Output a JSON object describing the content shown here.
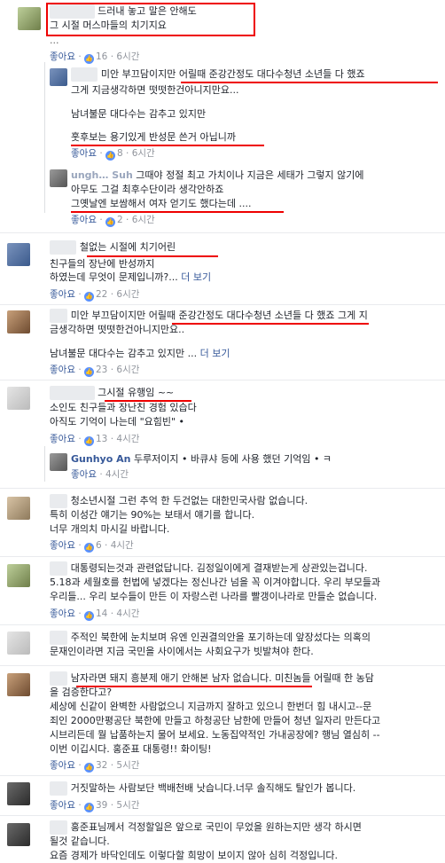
{
  "comments": [
    {
      "name": "",
      "lines": [
        "드러내 놓고 말은 안해도",
        "그 시절 머스마들의 치기지요"
      ],
      "extra": "...",
      "likes": "16",
      "time": "6시간"
    },
    {
      "name": "",
      "lines": [
        "미안 부끄담이지만 어릴때 준강간정도 대다수청년 소년들 다 했죠",
        "그게 지금생각하면 떳떳한건아니지만요...",
        "",
        "남녀불문 대다수는 감추고 있지만",
        "",
        "훗후보는 용기있게 반성문 쓴거 아닙니까"
      ],
      "likes": "8",
      "time": "6시간"
    },
    {
      "name": "ungh… Suh",
      "lines": [
        "그때야 정절 최고 가치이나 지금은 세태가 그렇지 않기에",
        "아무도 그걸 최후수단이라 생각안하죠",
        "그옛날엔 보쌈해서 여자 얻기도 했다는데 ...."
      ],
      "likes": "2",
      "time": "6시간"
    },
    {
      "name": "",
      "lines": [
        "철없는 시절에 치기어린",
        "친구들의 장난에 반성까지",
        "하였는데 무엇이 문제입니까?..."
      ],
      "more": "더 보기",
      "likes": "22",
      "time": "6시간"
    },
    {
      "name": "",
      "lines": [
        "미안 부끄담이지만 어릴때 준강간정도 대다수청년 소년들 다 했죠 그게 지",
        "금생각하면 떳떳한건아니지만요..",
        "",
        "남녀불문 대다수는 감추고 있지만 ..."
      ],
      "more": "더 보기",
      "likes": "23",
      "time": "6시간"
    },
    {
      "name": "",
      "lines": [
        "그시절 유행임 ~~",
        "소인도 친구들과 장난친 경험 있습다",
        "아직도 기억이 나는데 \"요힘빈\" •"
      ],
      "likes": "13",
      "time": "4시간"
    },
    {
      "name": "Gunhyo An",
      "lines": [
        "두루저이지 • 바큐샤 등에 사용 했던 기억임 • ㅋ"
      ],
      "time": "4시간"
    },
    {
      "name": "",
      "lines": [
        "청소년시절 그런 추억 한 두건없는 대한민국사람 없습니다.",
        "특히 이성간 얘기는 90%는 보태서 얘기를 합니다.",
        "너무 개의치 마시길 바랍니다."
      ],
      "likes": "6",
      "time": "4시간"
    },
    {
      "name": "",
      "lines": [
        "대통령되는것과 관련없답니다. 김정일이에게 결재받는게 상관있는겁니다.",
        "5.18과 세월호를 헌법에 넣겠다는 정신나간 넘을 꼭 이겨야합니다. 우리 부모들과",
        "우리들... 우리 보수들이 만든 이 자랑스런 나라를 빨갱이나라로 만들순 없습니다."
      ],
      "likes": "14",
      "time": "4시간"
    },
    {
      "name": "",
      "lines": [
        "주적인 북한에 눈치보며 유엔 인권결의안을 포기하는데 앞장섰다는 의혹의",
        "문재인이라면 지금 국민을 사이에서는 사회요구가 빗발쳐야 한다."
      ],
      "time": ""
    },
    {
      "name": "",
      "lines": [
        "남자라면 돼지 흥분제 애기 안해본 남자 없습니다. 미친놈들 어릴때 한 농담",
        "을 검증한다고?",
        "세상에 신같이 완벽한 사람없으니 지금까지 잘하고 있으니 한번더 힘 내시고--문",
        "죄인 2000만평공단 북한에 만들고 하청공단 남한에 만들어 청년 일자리 만든다고",
        "시브리든데 뭘 납품하는지 물어 보세요. 노동집약적인 가내공장에? 행님 열심히 --",
        "이번 이깁시다. 홍준표 대통령!! 화이팅!"
      ],
      "likes": "32",
      "time": "5시간"
    },
    {
      "name": "",
      "lines": [
        "거짓말하는 사람보단 백배천배 낫습니다.너무 솔직해도 탈인가 봅니다."
      ],
      "likes": "39",
      "time": "5시간"
    },
    {
      "name": "",
      "lines": [
        "홍준표님께서 걱정할일은 앞으로 국민이 무었을 원하는지만 생각 하시면",
        "될것 같습니다.",
        "요즘 경제가 바닥인데도 이렇다할 희망이 보이지 않아 심히 걱정입니다."
      ],
      "likes": "",
      "time": ""
    }
  ],
  "ui": {
    "like_label": "좋아요",
    "like_icon": "like-thumb-icon",
    "accent": "#e00000",
    "link": "#365899"
  }
}
